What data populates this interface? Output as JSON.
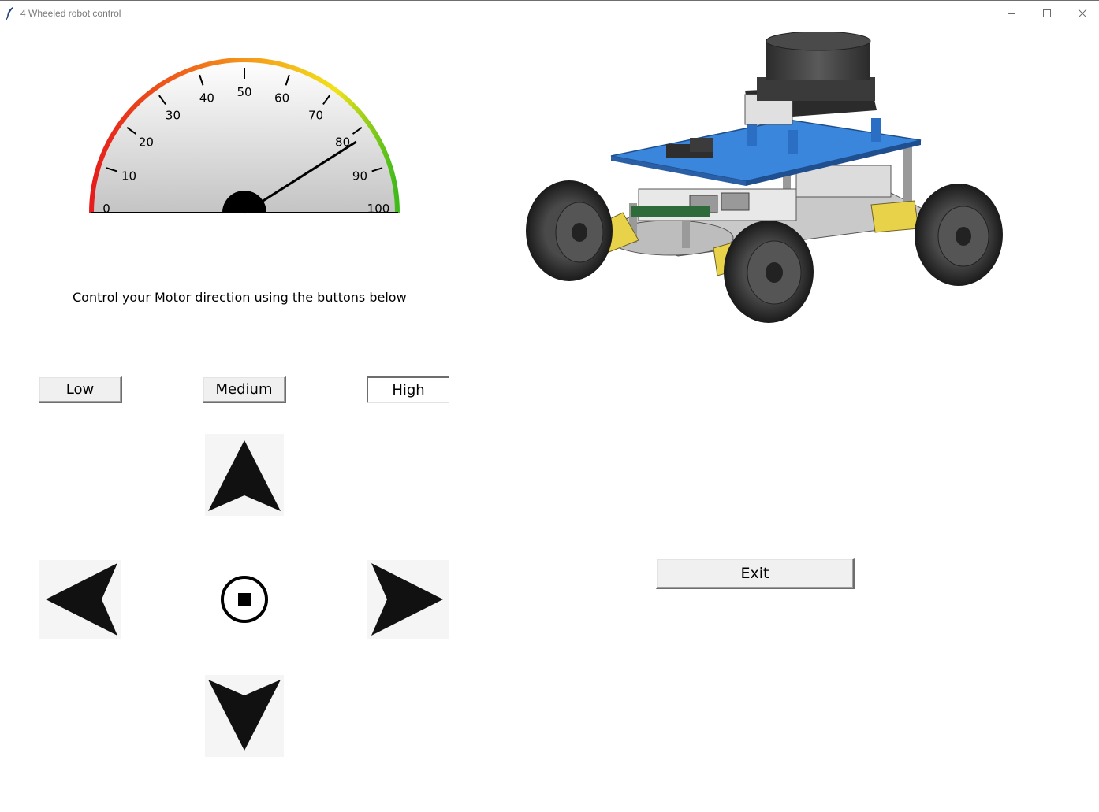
{
  "window": {
    "title": "4 Wheeled robot control"
  },
  "gauge": {
    "tick_labels": [
      "0",
      "10",
      "20",
      "30",
      "40",
      "50",
      "60",
      "70",
      "80",
      "90",
      "100"
    ],
    "min": 0,
    "max": 100,
    "value": 82
  },
  "instructions": "Control your Motor direction using the buttons below",
  "speed_buttons": {
    "low": "Low",
    "medium": "Medium",
    "high": "High",
    "selected": "High"
  },
  "exit_label": "Exit",
  "colors": {
    "robot_plate": "#3a86dc",
    "gauge_red": "#e51c1c",
    "gauge_orange": "#f08a1a",
    "gauge_yellow": "#f2e21a",
    "gauge_green": "#3dba1a",
    "arrow": "#111111",
    "button_face": "#f0f0f0"
  }
}
